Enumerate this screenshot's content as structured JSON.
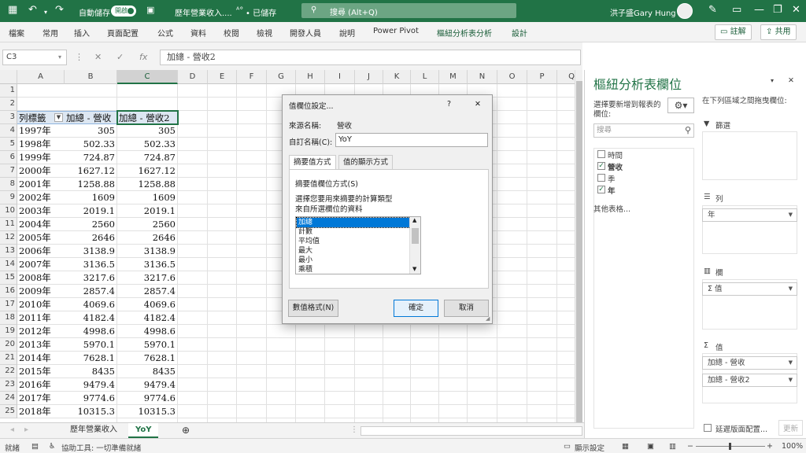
{
  "titlebar": {
    "autosave_label": "自動儲存",
    "autosave_state": "開啟",
    "file_name": "歷年營業收入....",
    "save_state": "• 已儲存",
    "search_placeholder": "搜尋 (Alt+Q)",
    "user_name": "洪子盛Gary Hung"
  },
  "ribbon": {
    "tabs": [
      "檔案",
      "常用",
      "插入",
      "頁面配置",
      "公式",
      "資料",
      "校閱",
      "檢視",
      "開發人員",
      "說明",
      "Power Pivot",
      "樞紐分析表分析",
      "設計"
    ],
    "comment_label": "註解",
    "share_label": "共用"
  },
  "formula_bar": {
    "cell_ref": "C3",
    "cancel_icon": "✕",
    "enter_icon": "✓",
    "fx_label": "fx",
    "content": "加總 - 營收2"
  },
  "grid": {
    "columns": [
      "A",
      "B",
      "C",
      "D",
      "E",
      "F",
      "G",
      "H",
      "I",
      "J",
      "K",
      "L",
      "M",
      "N",
      "O",
      "P",
      "Q"
    ],
    "rows": [
      "1",
      "2",
      "3",
      "4",
      "5",
      "6",
      "7",
      "8",
      "9",
      "10",
      "11",
      "12",
      "13",
      "14",
      "15",
      "16",
      "17",
      "18",
      "19",
      "20",
      "21",
      "22",
      "23",
      "24",
      "25"
    ],
    "pivot_header": [
      "列標籤",
      "加總 - 營收",
      "加總 - 營收2"
    ],
    "pivot_rows": [
      [
        "1997年",
        "305",
        "305"
      ],
      [
        "1998年",
        "502.33",
        "502.33"
      ],
      [
        "1999年",
        "724.87",
        "724.87"
      ],
      [
        "2000年",
        "1627.12",
        "1627.12"
      ],
      [
        "2001年",
        "1258.88",
        "1258.88"
      ],
      [
        "2002年",
        "1609",
        "1609"
      ],
      [
        "2003年",
        "2019.1",
        "2019.1"
      ],
      [
        "2004年",
        "2560",
        "2560"
      ],
      [
        "2005年",
        "2646",
        "2646"
      ],
      [
        "2006年",
        "3138.9",
        "3138.9"
      ],
      [
        "2007年",
        "3136.5",
        "3136.5"
      ],
      [
        "2008年",
        "3217.6",
        "3217.6"
      ],
      [
        "2009年",
        "2857.4",
        "2857.4"
      ],
      [
        "2010年",
        "4069.6",
        "4069.6"
      ],
      [
        "2011年",
        "4182.4",
        "4182.4"
      ],
      [
        "2012年",
        "4998.6",
        "4998.6"
      ],
      [
        "2013年",
        "5970.1",
        "5970.1"
      ],
      [
        "2014年",
        "7628.1",
        "7628.1"
      ],
      [
        "2015年",
        "8435",
        "8435"
      ],
      [
        "2016年",
        "9479.4",
        "9479.4"
      ],
      [
        "2017年",
        "9774.6",
        "9774.6"
      ],
      [
        "2018年",
        "10315.3",
        "10315.3"
      ]
    ]
  },
  "sheets": {
    "tabs": [
      "歷年營業收入",
      "YoY"
    ],
    "active": "YoY"
  },
  "status": {
    "ready": "就緒",
    "accessibility": "協助工具: 一切準備就緒",
    "display_settings": "顯示設定",
    "zoom": "100%"
  },
  "pivot_pane": {
    "title": "樞紐分析表欄位",
    "choose_label_1": "選擇要新增到報表的",
    "choose_label_2": "欄位:",
    "drag_label": "在下列區域之間拖曳欄位:",
    "search_placeholder": "搜尋",
    "fields": [
      {
        "name": "時間",
        "checked": false
      },
      {
        "name": "營收",
        "checked": true
      },
      {
        "name": "季",
        "checked": false
      },
      {
        "name": "年",
        "checked": true
      }
    ],
    "more_tables": "其他表格...",
    "filters_label": "篩選",
    "rows_label": "列",
    "rows_value": "年",
    "columns_label": "欄",
    "columns_value": "Σ 值",
    "values_label": "值",
    "values_items": [
      "加總 - 營收",
      "加總 - 營收2"
    ],
    "defer_label": "延遲版面配置...",
    "update_label": "更新"
  },
  "dialog": {
    "title": "值欄位設定...",
    "help": "?",
    "close": "✕",
    "source_label": "來源名稱:",
    "source_value": "營收",
    "custom_name_label": "自訂名稱(C):",
    "custom_name_value": "YoY",
    "tabs": [
      "摘要值方式",
      "值的顯示方式"
    ],
    "summarize_label": "摘要值欄位方式(S)",
    "desc_1": "選擇您要用來摘要的計算類型",
    "desc_2": "來自所選欄位的資料",
    "options": [
      "加總",
      "計數",
      "平均值",
      "最大",
      "最小",
      "乘積"
    ],
    "selected": "加總",
    "number_format": "數值格式(N)",
    "ok": "確定",
    "cancel": "取消"
  }
}
